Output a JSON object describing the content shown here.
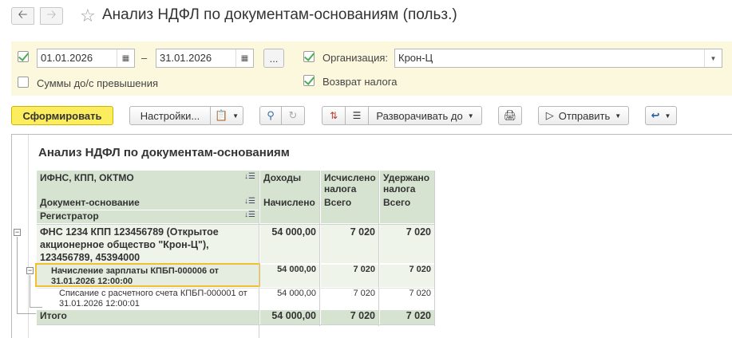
{
  "window": {
    "title": "Анализ НДФЛ по документам-основаниям (польз.)",
    "back_icon": "arrow-left-icon",
    "forward_icon": "arrow-right-icon",
    "favorite_icon": "star-icon"
  },
  "filters": {
    "period_from": "01.01.2026",
    "period_to": "31.01.2026",
    "period_dash": "–",
    "period_more": "...",
    "organization_label": "Организация:",
    "organization_value": "Крон-Ц",
    "amounts_exceed_label": "Суммы до/с превышения",
    "tax_refund_label": "Возврат налога",
    "period_checked": true,
    "organization_checked": true,
    "amounts_exceed_checked": false,
    "tax_refund_checked": true
  },
  "toolbar": {
    "generate": "Сформировать",
    "settings": "Настройки...",
    "expand_to": "Разворачивать до",
    "send": "Отправить"
  },
  "report": {
    "title": "Анализ НДФЛ по документам-основаниям",
    "headers": {
      "ifns": "ИФНС, КПП, ОКТМО",
      "income": "Доходы",
      "calculated": "Исчислено налога",
      "withheld": "Удержано налога",
      "doc_basis": "Документ-основание",
      "accrued": "Начислено",
      "total1": "Всего",
      "total2": "Всего",
      "registrar": "Регистратор"
    },
    "group": {
      "name": "ФНС 1234 КПП 123456789 (Открытое акционерное общество \"Крон-Ц\"), 123456789, 45394000",
      "income": "54 000,00",
      "calculated": "7 020",
      "withheld": "7 020"
    },
    "rows": [
      {
        "name": "Начисление зарплаты КПБП-000006 от 31.01.2026 12:00:00",
        "income": "54 000,00",
        "calculated": "7 020",
        "withheld": "7 020"
      },
      {
        "name": "Списание с расчетного счета КПБП-000001 от 31.01.2026 12:00:01",
        "income": "54 000,00",
        "calculated": "7 020",
        "withheld": "7 020"
      }
    ],
    "total": {
      "label": "Итого",
      "income": "54 000,00",
      "calculated": "7 020",
      "withheld": "7 020"
    }
  }
}
